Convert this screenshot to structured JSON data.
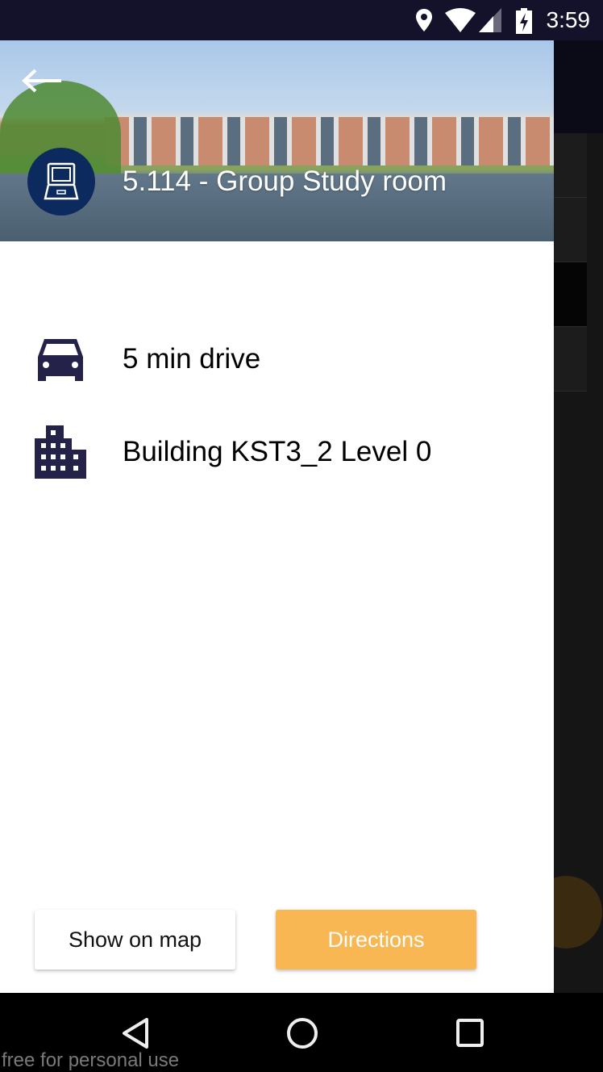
{
  "status_bar": {
    "time": "3:59",
    "icons": [
      "location-icon",
      "wifi-icon",
      "signal-icon",
      "battery-charging-icon"
    ]
  },
  "header": {
    "title": "5.114 - Group Study room",
    "avatar_icon": "laptop-icon",
    "back_icon": "arrow-left-icon"
  },
  "details": [
    {
      "icon": "car-icon",
      "text": "5 min drive"
    },
    {
      "icon": "building-icon",
      "text": "Building KST3_2 Level 0"
    }
  ],
  "actions": {
    "show_on_map": "Show on map",
    "directions": "Directions"
  },
  "colors": {
    "status_bar": "#14122b",
    "avatar": "#0d2a5e",
    "icon": "#25224a",
    "directions": "#f8b752"
  },
  "watermark": "free for personal use"
}
